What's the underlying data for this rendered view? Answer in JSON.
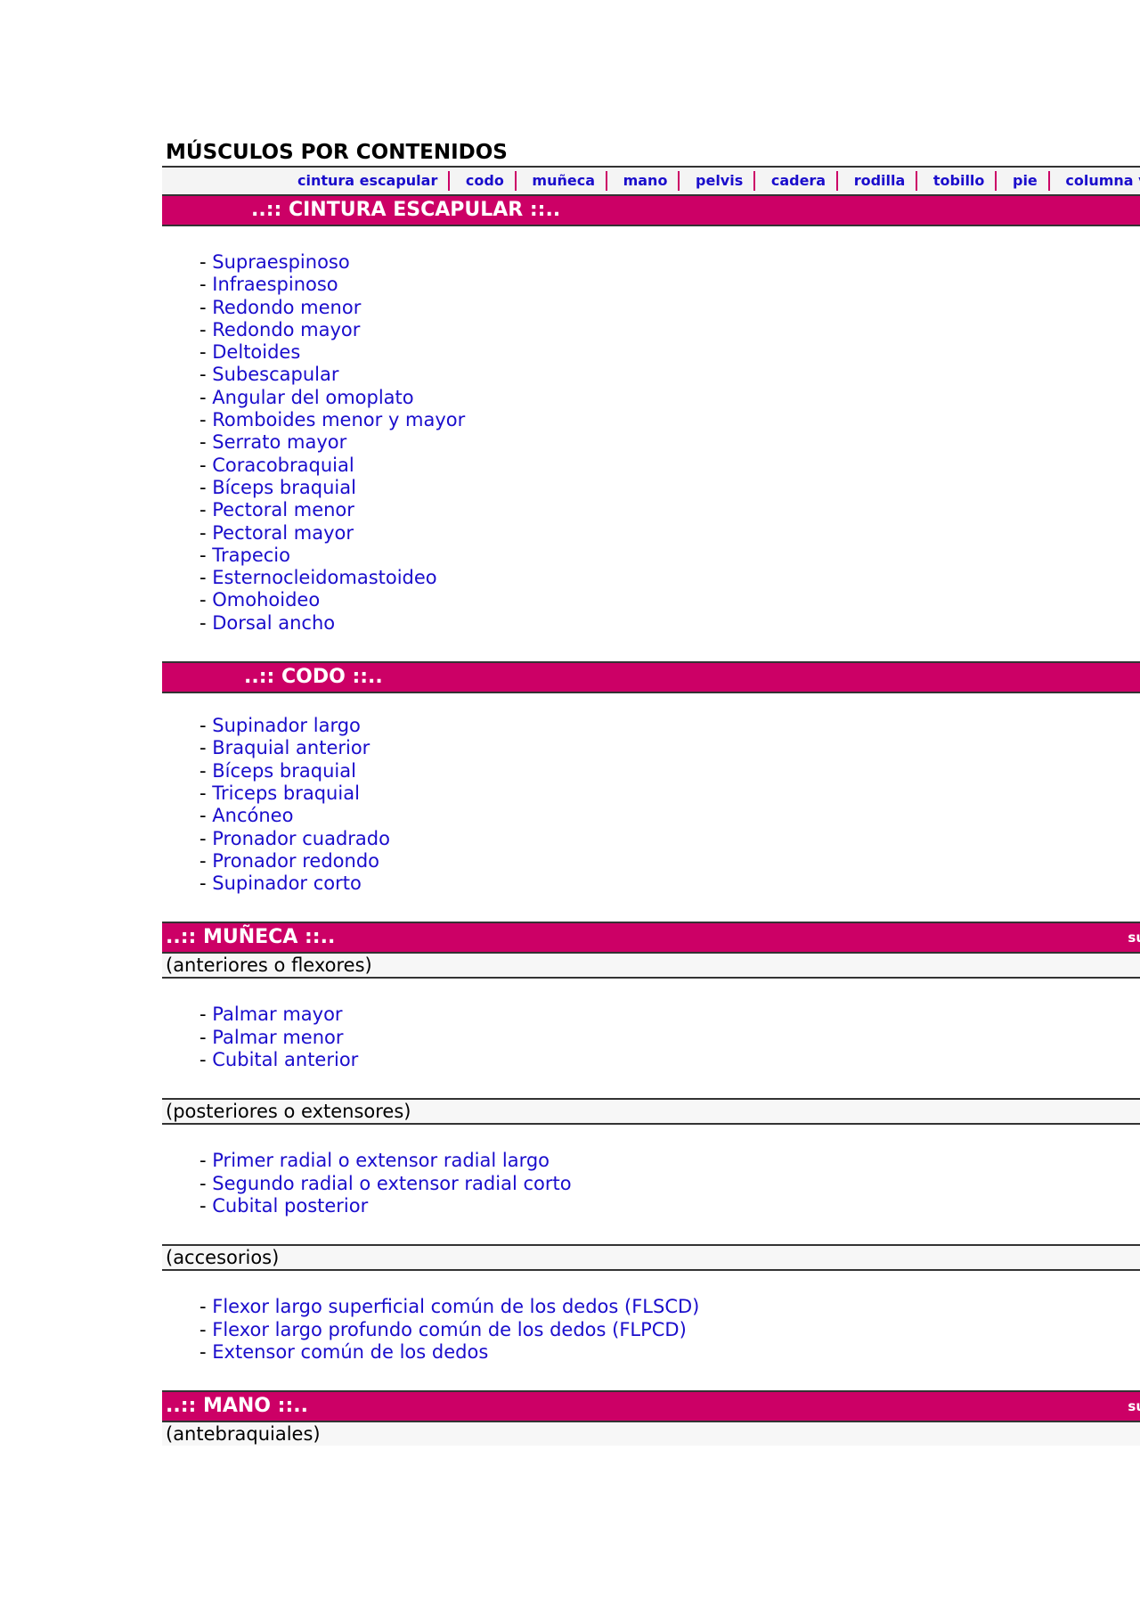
{
  "title": "MÚSCULOS POR CONTENIDOS",
  "nav": [
    "cintura escapular",
    "codo",
    "muñeca",
    "mano",
    "pelvis",
    "cadera",
    "rodilla",
    "tobillo",
    "pie",
    "columna ve"
  ],
  "dash": "- ",
  "sections": {
    "cintura": {
      "title": "..:: CINTURA ESCAPULAR ::..",
      "items": [
        "Supraespinoso",
        "Infraespinoso",
        "Redondo menor",
        "Redondo mayor",
        "Deltoides",
        "Subescapular",
        "Angular del omoplato",
        "Romboides menor y mayor",
        "Serrato mayor",
        "Coracobraquial",
        "Bíceps braquial",
        "Pectoral menor",
        "Pectoral mayor",
        "Trapecio",
        "Esternocleidomastoideo",
        "Omohoideo",
        "Dorsal ancho"
      ]
    },
    "codo": {
      "title": "..:: CODO ::..",
      "items": [
        "Supinador largo",
        "Braquial anterior",
        "Bíceps braquial",
        "Triceps braquial",
        "Ancóneo",
        "Pronador cuadrado",
        "Pronador redondo",
        "Supinador corto"
      ]
    },
    "muneca": {
      "title": "..:: MUÑECA ::..",
      "right": "su",
      "groups": [
        {
          "label": "(anteriores o flexores)",
          "items": [
            "Palmar mayor",
            "Palmar menor",
            "Cubital anterior"
          ]
        },
        {
          "label": "(posteriores o extensores)",
          "items": [
            "Primer radial o extensor radial largo",
            "Segundo radial o extensor radial corto",
            "Cubital posterior"
          ]
        },
        {
          "label": "(accesorios)",
          "items": [
            "Flexor largo superficial común de los dedos (FLSCD)",
            "Flexor largo profundo común de los dedos (FLPCD)",
            "Extensor común de los dedos"
          ]
        }
      ]
    },
    "mano": {
      "title": "..:: MANO ::..",
      "right": "su",
      "groups": [
        {
          "label": "(antebraquiales)"
        }
      ]
    }
  }
}
